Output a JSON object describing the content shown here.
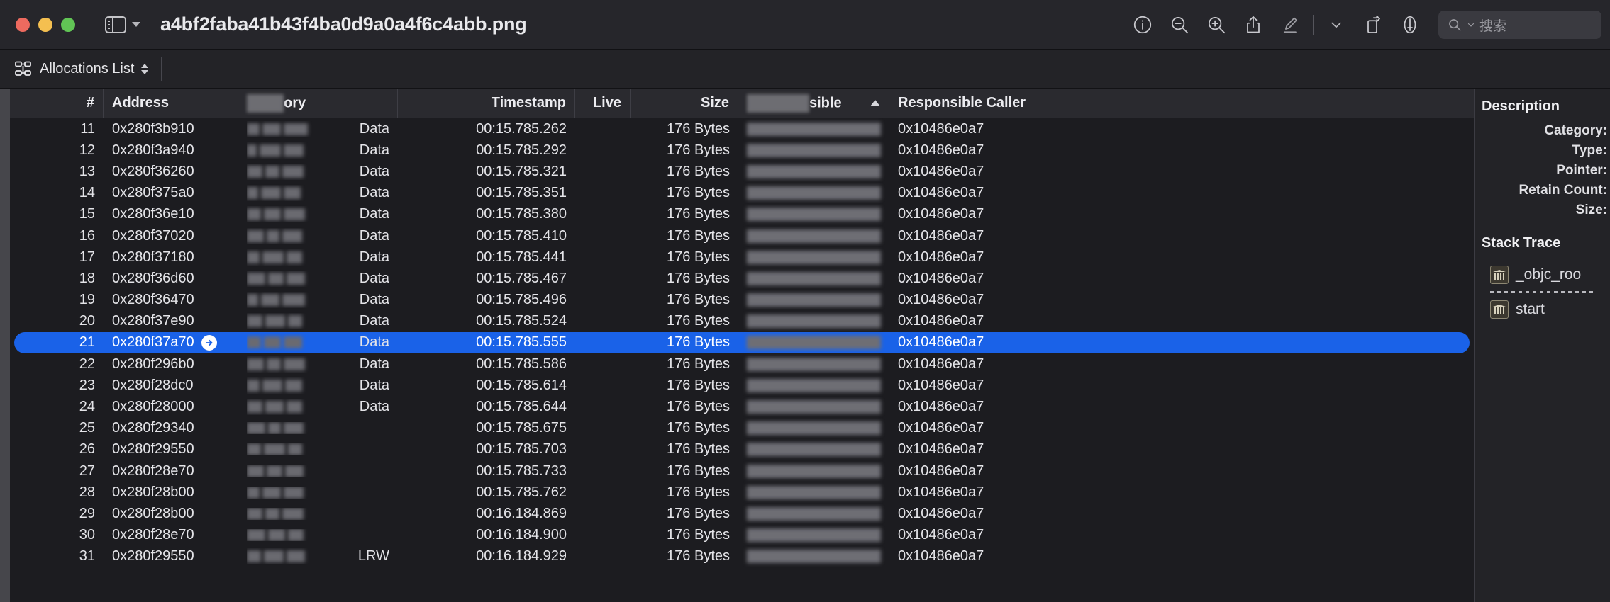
{
  "window": {
    "title": "a4bf2faba41b43f4ba0d9a0a4f6c4abb.png",
    "traffic_lights": [
      "close-button",
      "minimize-button",
      "maximize-button"
    ],
    "sidebar_toggle_label": "sidebar-toggle",
    "colors": {
      "close": "#ed6a5f",
      "minimize": "#f4bf50",
      "maximize": "#61c555",
      "selection": "#1a62e8"
    }
  },
  "toolbar": {
    "items": [
      {
        "name": "info-icon",
        "label": "Info"
      },
      {
        "name": "zoom-out-icon",
        "label": "Zoom Out"
      },
      {
        "name": "zoom-in-icon",
        "label": "Zoom In"
      },
      {
        "name": "share-icon",
        "label": "Share"
      },
      {
        "name": "markup-pen-icon",
        "label": "Markup"
      },
      {
        "name": "chevron-down-icon",
        "label": "More"
      },
      {
        "name": "rotate-icon",
        "label": "Rotate"
      },
      {
        "name": "annotate-icon",
        "label": "Annotate"
      }
    ],
    "search": {
      "placeholder": "搜索",
      "value": ""
    }
  },
  "jumpbar": {
    "icon": "allocations-graph-icon",
    "label": "Allocations List"
  },
  "table": {
    "columns": [
      {
        "key": "num",
        "label": "#",
        "align": "right",
        "redacted": false,
        "sorted": false
      },
      {
        "key": "addr",
        "label": "Address",
        "align": "left",
        "redacted": false,
        "sorted": false
      },
      {
        "key": "cat",
        "label": "Category",
        "align": "left",
        "redacted": true,
        "sorted": false
      },
      {
        "key": "ts",
        "label": "Timestamp",
        "align": "right",
        "redacted": false,
        "sorted": false
      },
      {
        "key": "live",
        "label": "Live",
        "align": "right",
        "redacted": false,
        "sorted": false
      },
      {
        "key": "size",
        "label": "Size",
        "align": "right",
        "redacted": false,
        "sorted": false
      },
      {
        "key": "resp",
        "label": "Responsible",
        "align": "left",
        "redacted": true,
        "sorted": "ascending"
      },
      {
        "key": "call",
        "label": "Responsible Caller",
        "align": "left",
        "redacted": false,
        "sorted": false
      }
    ],
    "selected_row_index": 10,
    "rows": [
      {
        "num": "11",
        "addr": "0x280f3b910",
        "cat": "Data",
        "ts": "00:15.785.262",
        "live": "",
        "size": "176 Bytes",
        "resp": "",
        "call": "0x10486e0a7"
      },
      {
        "num": "12",
        "addr": "0x280f3a940",
        "cat": "Data",
        "ts": "00:15.785.292",
        "live": "",
        "size": "176 Bytes",
        "resp": "",
        "call": "0x10486e0a7"
      },
      {
        "num": "13",
        "addr": "0x280f36260",
        "cat": "Data",
        "ts": "00:15.785.321",
        "live": "",
        "size": "176 Bytes",
        "resp": "",
        "call": "0x10486e0a7"
      },
      {
        "num": "14",
        "addr": "0x280f375a0",
        "cat": "Data",
        "ts": "00:15.785.351",
        "live": "",
        "size": "176 Bytes",
        "resp": "",
        "call": "0x10486e0a7"
      },
      {
        "num": "15",
        "addr": "0x280f36e10",
        "cat": "Data",
        "ts": "00:15.785.380",
        "live": "",
        "size": "176 Bytes",
        "resp": "",
        "call": "0x10486e0a7"
      },
      {
        "num": "16",
        "addr": "0x280f37020",
        "cat": "Data",
        "ts": "00:15.785.410",
        "live": "",
        "size": "176 Bytes",
        "resp": "",
        "call": "0x10486e0a7"
      },
      {
        "num": "17",
        "addr": "0x280f37180",
        "cat": "Data",
        "ts": "00:15.785.441",
        "live": "",
        "size": "176 Bytes",
        "resp": "",
        "call": "0x10486e0a7"
      },
      {
        "num": "18",
        "addr": "0x280f36d60",
        "cat": "Data",
        "ts": "00:15.785.467",
        "live": "",
        "size": "176 Bytes",
        "resp": "",
        "call": "0x10486e0a7"
      },
      {
        "num": "19",
        "addr": "0x280f36470",
        "cat": "Data",
        "ts": "00:15.785.496",
        "live": "",
        "size": "176 Bytes",
        "resp": "",
        "call": "0x10486e0a7"
      },
      {
        "num": "20",
        "addr": "0x280f37e90",
        "cat": "Data",
        "ts": "00:15.785.524",
        "live": "",
        "size": "176 Bytes",
        "resp": "",
        "call": "0x10486e0a7"
      },
      {
        "num": "21",
        "addr": "0x280f37a70",
        "cat": "Data",
        "ts": "00:15.785.555",
        "live": "",
        "size": "176 Bytes",
        "resp": "",
        "call": "0x10486e0a7",
        "badge": "arrow-right-circle-icon"
      },
      {
        "num": "22",
        "addr": "0x280f296b0",
        "cat": "Data",
        "ts": "00:15.785.586",
        "live": "",
        "size": "176 Bytes",
        "resp": "",
        "call": "0x10486e0a7"
      },
      {
        "num": "23",
        "addr": "0x280f28dc0",
        "cat": "Data",
        "ts": "00:15.785.614",
        "live": "",
        "size": "176 Bytes",
        "resp": "",
        "call": "0x10486e0a7"
      },
      {
        "num": "24",
        "addr": "0x280f28000",
        "cat": "Data",
        "ts": "00:15.785.644",
        "live": "",
        "size": "176 Bytes",
        "resp": "",
        "call": "0x10486e0a7"
      },
      {
        "num": "25",
        "addr": "0x280f29340",
        "cat": "",
        "ts": "00:15.785.675",
        "live": "",
        "size": "176 Bytes",
        "resp": "",
        "call": "0x10486e0a7"
      },
      {
        "num": "26",
        "addr": "0x280f29550",
        "cat": "",
        "ts": "00:15.785.703",
        "live": "",
        "size": "176 Bytes",
        "resp": "",
        "call": "0x10486e0a7"
      },
      {
        "num": "27",
        "addr": "0x280f28e70",
        "cat": "",
        "ts": "00:15.785.733",
        "live": "",
        "size": "176 Bytes",
        "resp": "",
        "call": "0x10486e0a7"
      },
      {
        "num": "28",
        "addr": "0x280f28b00",
        "cat": "",
        "ts": "00:15.785.762",
        "live": "",
        "size": "176 Bytes",
        "resp": "",
        "call": "0x10486e0a7"
      },
      {
        "num": "29",
        "addr": "0x280f28b00",
        "cat": "",
        "ts": "00:16.184.869",
        "live": "",
        "size": "176 Bytes",
        "resp": "",
        "call": "0x10486e0a7"
      },
      {
        "num": "30",
        "addr": "0x280f28e70",
        "cat": "",
        "ts": "00:16.184.900",
        "live": "",
        "size": "176 Bytes",
        "resp": "",
        "call": "0x10486e0a7"
      },
      {
        "num": "31",
        "addr": "0x280f29550",
        "cat": "LRW",
        "ts": "00:16.184.929",
        "live": "",
        "size": "176 Bytes",
        "resp": "",
        "call": "0x10486e0a7"
      }
    ]
  },
  "inspector": {
    "description_title": "Description",
    "fields": [
      {
        "label": "Category:",
        "value": ""
      },
      {
        "label": "Type:",
        "value": ""
      },
      {
        "label": "Pointer:",
        "value": ""
      },
      {
        "label": "Retain Count:",
        "value": ""
      },
      {
        "label": "Size:",
        "value": ""
      }
    ],
    "stack_trace_title": "Stack Trace",
    "stack_frames": [
      {
        "icon": "library-icon",
        "label": "_objc_roo"
      },
      {
        "icon": "library-icon",
        "label": "start"
      }
    ]
  }
}
